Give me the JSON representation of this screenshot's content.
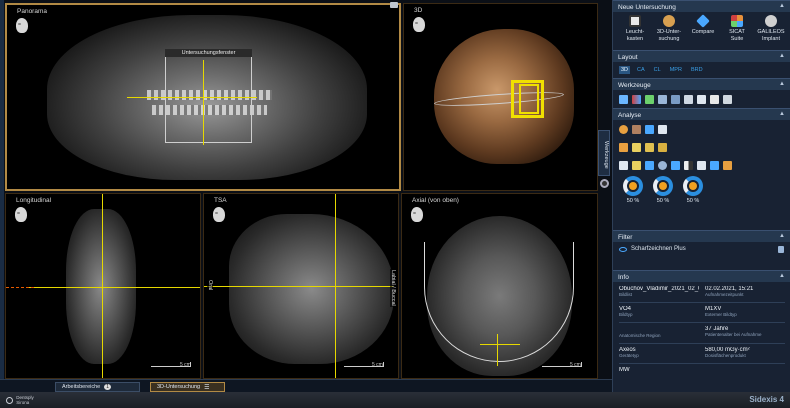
{
  "viewports": {
    "panorama": {
      "title": "Panorama",
      "window_label": "Untersuchungsfenster"
    },
    "view3d": {
      "title": "3D"
    },
    "longitudinal": {
      "title": "Longitudinal",
      "scale": "5 cm"
    },
    "tsa": {
      "title": "TSA",
      "scale": "5 cm",
      "label_left": "Oral",
      "label_right": "Labial / Buccal"
    },
    "axial": {
      "title": "Axial (von oben)",
      "scale": "5 cm"
    }
  },
  "panel": {
    "neue_untersuchung": {
      "title": "Neue Untersuchung",
      "tools": [
        {
          "label": "Leucht-\nkasten",
          "color": "#e8e8e8"
        },
        {
          "label": "3D-Unter-\nsuchung",
          "color": "#d8a050"
        },
        {
          "label": "Compare",
          "color": "#4aa8ff"
        },
        {
          "label": "SICAT\nSuite",
          "color": "#e8903a"
        },
        {
          "label": "GALILEOS\nImplant",
          "color": "#d0d0d0"
        }
      ]
    },
    "layout": {
      "title": "Layout",
      "options": [
        "3D",
        "CA",
        "CL",
        "MPR",
        "BRD"
      ],
      "selected": "3D"
    },
    "werkzeuge": {
      "title": "Werkzeuge",
      "tab_label": "Werkzeuge"
    },
    "analyse": {
      "title": "Analyse",
      "rings": [
        "50 %",
        "50 %",
        "50 %"
      ]
    },
    "filter": {
      "title": "Filter",
      "item": "Scharfzeichnen Plus"
    },
    "info": {
      "title": "Info",
      "rows": [
        {
          "v1": "Obuchov_Vladimir_2021_02_0",
          "c1": "Bildlist",
          "v2": "02.02.2021, 15:21",
          "c2": "Aufnahmezeitpunkt"
        },
        {
          "v1": "VO4",
          "c1": "Bildtyp",
          "v2": "M1XV",
          "c2": "Externer Bildtyp"
        },
        {
          "v1": "",
          "c1": "Anatomische Region",
          "v2": "37 Jahre",
          "c2": "Patientenalter bei Aufnahme"
        },
        {
          "v1": "Axeos",
          "c1": "Gerätetyp",
          "v2": "580,00 mGy·cm²",
          "c2": "Dosisflächenprodukt"
        },
        {
          "v1": "MW",
          "c1": "",
          "v2": "",
          "c2": ""
        }
      ]
    }
  },
  "tabbar": {
    "workspaces_label": "Arbeitsbereiche",
    "workspaces_count": "1",
    "current_tab": "3D-Untersuchung"
  },
  "footer": {
    "brand_line1": "Dentsply",
    "brand_line2": "Sirona",
    "product": "Sidexis 4"
  }
}
